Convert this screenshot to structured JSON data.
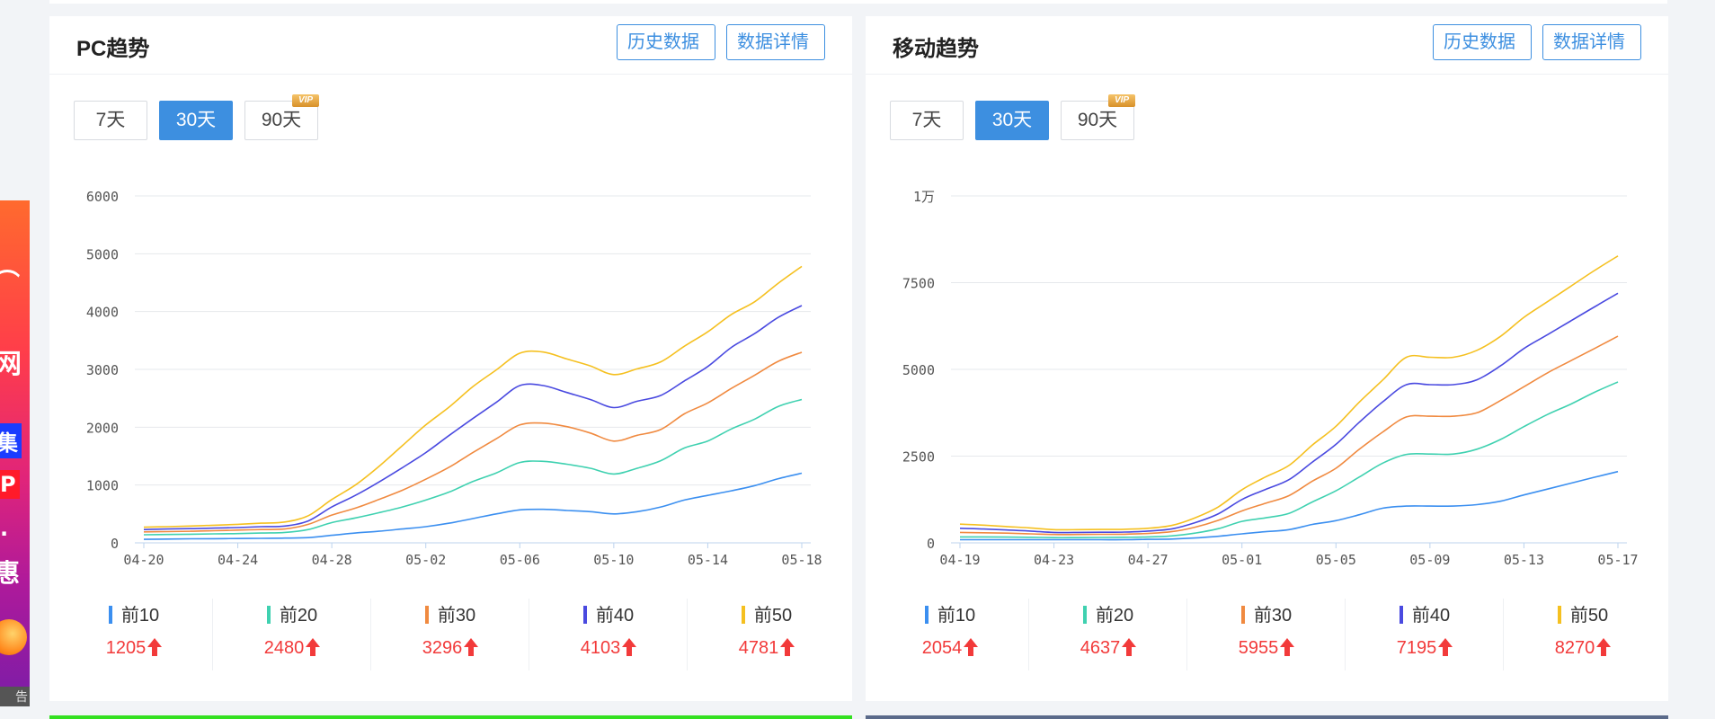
{
  "ad": {
    "glyph_wifi": "⌒",
    "glyph1": "网",
    "glyph2": "集",
    "glyph3": "P",
    "glyph4": "·",
    "glyph5": "惠",
    "label": "告"
  },
  "periods": {
    "p7": "7天",
    "p30": "30天",
    "p90": "90天",
    "vip": "VIP"
  },
  "colors": {
    "accent": "#3d8fe0",
    "up": "#f23a3a",
    "top10": "#3b8ff0",
    "top20": "#3fd1b0",
    "top30": "#f08a40",
    "top40": "#4a4ae0",
    "top50": "#f5c020"
  },
  "pc": {
    "title": "PC趋势",
    "history_btn": "历史数据",
    "detail_btn": "数据详情",
    "legend": [
      {
        "label": "前10",
        "value": "1205"
      },
      {
        "label": "前20",
        "value": "2480"
      },
      {
        "label": "前30",
        "value": "3296"
      },
      {
        "label": "前40",
        "value": "4103"
      },
      {
        "label": "前50",
        "value": "4781"
      }
    ]
  },
  "mobile": {
    "title": "移动趋势",
    "history_btn": "历史数据",
    "detail_btn": "数据详情",
    "legend": [
      {
        "label": "前10",
        "value": "2054"
      },
      {
        "label": "前20",
        "value": "4637"
      },
      {
        "label": "前30",
        "value": "5955"
      },
      {
        "label": "前40",
        "value": "7195"
      },
      {
        "label": "前50",
        "value": "8270"
      }
    ]
  },
  "chart_data": [
    {
      "type": "line",
      "title": "PC趋势",
      "xlabel": "",
      "ylabel": "",
      "ylim": [
        0,
        6000
      ],
      "yticks": [
        0,
        1000,
        2000,
        3000,
        4000,
        5000,
        6000
      ],
      "ytick_labels": [
        "0",
        "1000",
        "2000",
        "3000",
        "4000",
        "5000",
        "6000"
      ],
      "x": [
        "04-20",
        "04-21",
        "04-22",
        "04-23",
        "04-24",
        "04-25",
        "04-26",
        "04-27",
        "04-28",
        "04-29",
        "04-30",
        "05-01",
        "05-02",
        "05-03",
        "05-04",
        "05-05",
        "05-06",
        "05-07",
        "05-08",
        "05-09",
        "05-10",
        "05-11",
        "05-12",
        "05-13",
        "05-14",
        "05-15",
        "05-16",
        "05-17",
        "05-18"
      ],
      "xtick_labels": [
        "04-20",
        "04-24",
        "04-28",
        "05-02",
        "05-06",
        "05-10",
        "05-14",
        "05-18"
      ],
      "grid": true,
      "legend": "bottom",
      "series": [
        {
          "name": "前10",
          "values": [
            60,
            65,
            70,
            72,
            75,
            78,
            82,
            90,
            130,
            170,
            200,
            240,
            280,
            340,
            420,
            500,
            570,
            580,
            560,
            540,
            500,
            540,
            620,
            740,
            820,
            900,
            990,
            1110,
            1205
          ]
        },
        {
          "name": "前20",
          "values": [
            140,
            145,
            150,
            155,
            160,
            170,
            180,
            230,
            350,
            430,
            520,
            620,
            740,
            880,
            1060,
            1210,
            1390,
            1410,
            1360,
            1290,
            1190,
            1290,
            1420,
            1640,
            1760,
            1970,
            2140,
            2360,
            2480
          ]
        },
        {
          "name": "前30",
          "values": [
            190,
            195,
            200,
            210,
            220,
            230,
            240,
            320,
            480,
            600,
            750,
            910,
            1100,
            1310,
            1560,
            1800,
            2040,
            2070,
            2010,
            1900,
            1760,
            1860,
            1960,
            2230,
            2420,
            2670,
            2900,
            3140,
            3296
          ]
        },
        {
          "name": "前40",
          "values": [
            230,
            240,
            245,
            255,
            265,
            280,
            290,
            380,
            620,
            820,
            1050,
            1300,
            1560,
            1860,
            2150,
            2430,
            2720,
            2720,
            2600,
            2480,
            2340,
            2450,
            2550,
            2800,
            3050,
            3380,
            3620,
            3900,
            4103
          ]
        },
        {
          "name": "前50",
          "values": [
            270,
            280,
            290,
            305,
            320,
            340,
            360,
            470,
            750,
            1000,
            1320,
            1680,
            2040,
            2350,
            2700,
            2990,
            3280,
            3300,
            3180,
            3060,
            2910,
            3010,
            3130,
            3400,
            3650,
            3950,
            4170,
            4490,
            4781
          ]
        }
      ]
    },
    {
      "type": "line",
      "title": "移动趋势",
      "xlabel": "",
      "ylabel": "",
      "ylim": [
        0,
        10000
      ],
      "yticks": [
        0,
        2500,
        5000,
        7500,
        10000
      ],
      "ytick_labels": [
        "0",
        "2500",
        "5000",
        "7500",
        "1万"
      ],
      "x": [
        "04-19",
        "04-20",
        "04-21",
        "04-22",
        "04-23",
        "04-24",
        "04-25",
        "04-26",
        "04-27",
        "04-28",
        "04-29",
        "04-30",
        "05-01",
        "05-02",
        "05-03",
        "05-04",
        "05-05",
        "05-06",
        "05-07",
        "05-08",
        "05-09",
        "05-10",
        "05-11",
        "05-12",
        "05-13",
        "05-14",
        "05-15",
        "05-16",
        "05-17"
      ],
      "xtick_labels": [
        "04-19",
        "04-23",
        "04-27",
        "05-01",
        "05-05",
        "05-09",
        "05-13",
        "05-17"
      ],
      "grid": true,
      "legend": "bottom",
      "series": [
        {
          "name": "前10",
          "values": [
            90,
            90,
            90,
            90,
            90,
            90,
            90,
            90,
            100,
            110,
            140,
            190,
            260,
            320,
            380,
            530,
            640,
            810,
            1000,
            1060,
            1060,
            1060,
            1100,
            1200,
            1380,
            1550,
            1720,
            1890,
            2054
          ]
        },
        {
          "name": "前20",
          "values": [
            170,
            170,
            165,
            160,
            150,
            150,
            155,
            160,
            170,
            200,
            280,
            410,
            620,
            720,
            850,
            1180,
            1500,
            1900,
            2300,
            2550,
            2560,
            2560,
            2700,
            2980,
            3350,
            3700,
            4000,
            4340,
            4637
          ]
        },
        {
          "name": "前30",
          "values": [
            300,
            290,
            280,
            260,
            240,
            240,
            245,
            250,
            270,
            320,
            450,
            650,
            920,
            1140,
            1360,
            1780,
            2150,
            2700,
            3200,
            3630,
            3650,
            3650,
            3750,
            4100,
            4500,
            4900,
            5250,
            5600,
            5955
          ]
        },
        {
          "name": "前40",
          "values": [
            420,
            400,
            370,
            340,
            300,
            300,
            305,
            310,
            340,
            400,
            580,
            840,
            1250,
            1540,
            1820,
            2330,
            2840,
            3480,
            4070,
            4560,
            4560,
            4560,
            4700,
            5100,
            5600,
            6000,
            6400,
            6800,
            7195
          ]
        },
        {
          "name": "前50",
          "values": [
            540,
            510,
            470,
            430,
            380,
            380,
            385,
            390,
            420,
            500,
            720,
            1040,
            1530,
            1900,
            2230,
            2820,
            3360,
            4060,
            4700,
            5350,
            5350,
            5350,
            5550,
            5950,
            6500,
            6950,
            7400,
            7850,
            8270
          ]
        }
      ]
    }
  ]
}
